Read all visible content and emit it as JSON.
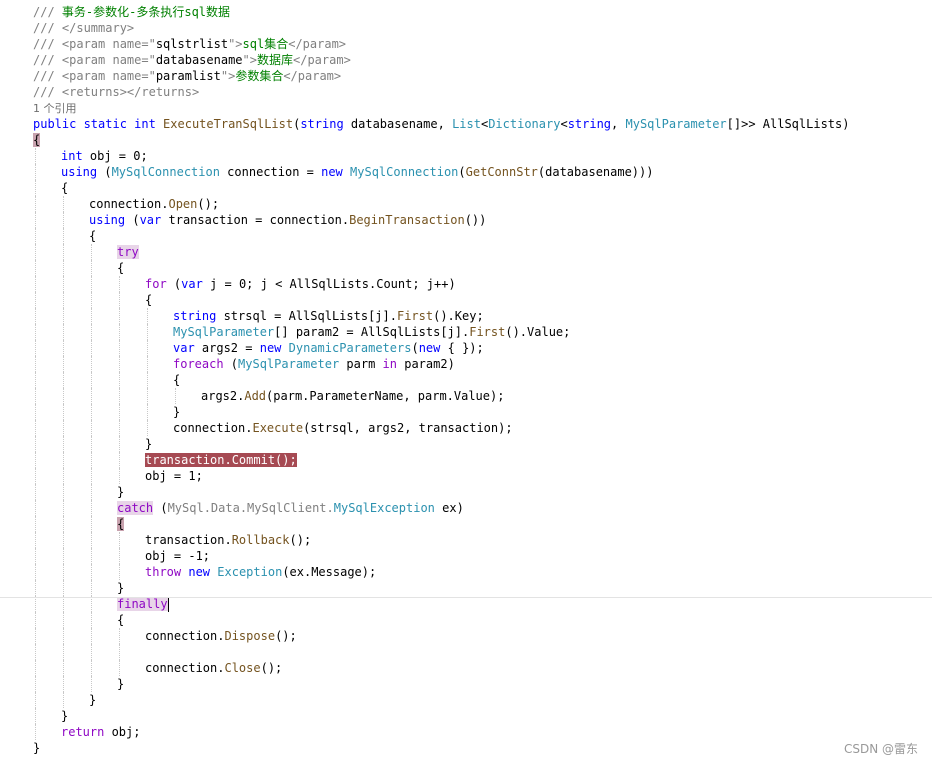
{
  "lines": [
    {
      "indent": 0,
      "tokens": [
        [
          "doc",
          "/// "
        ],
        [
          "comment",
          "事务-参数化-多条执行sql数据"
        ]
      ]
    },
    {
      "indent": 0,
      "tokens": [
        [
          "doc",
          "/// </summary>"
        ]
      ]
    },
    {
      "indent": 0,
      "tokens": [
        [
          "doc",
          "/// <param name=\""
        ],
        [
          "plain",
          "sqlstrlist"
        ],
        [
          "doc",
          "\">"
        ],
        [
          "comment",
          "sql集合"
        ],
        [
          "doc",
          "</param>"
        ]
      ]
    },
    {
      "indent": 0,
      "tokens": [
        [
          "doc",
          "/// <param name=\""
        ],
        [
          "plain",
          "databasename"
        ],
        [
          "doc",
          "\">"
        ],
        [
          "comment",
          "数据库"
        ],
        [
          "doc",
          "</param>"
        ]
      ]
    },
    {
      "indent": 0,
      "tokens": [
        [
          "doc",
          "/// <param name=\""
        ],
        [
          "plain",
          "paramlist"
        ],
        [
          "doc",
          "\">"
        ],
        [
          "comment",
          "参数集合"
        ],
        [
          "doc",
          "</param>"
        ]
      ]
    },
    {
      "indent": 0,
      "tokens": [
        [
          "doc",
          "/// <returns></returns>"
        ]
      ]
    },
    {
      "indent": 0,
      "tokens": [
        [
          "refs",
          "1 个引用"
        ]
      ]
    },
    {
      "indent": 0,
      "tokens": [
        [
          "kw",
          "public static int "
        ],
        [
          "method",
          "ExecuteTranSqlList"
        ],
        [
          "plain",
          "("
        ],
        [
          "kw",
          "string"
        ],
        [
          "plain",
          " databasename, "
        ],
        [
          "type",
          "List"
        ],
        [
          "plain",
          "<"
        ],
        [
          "type",
          "Dictionary"
        ],
        [
          "plain",
          "<"
        ],
        [
          "kw",
          "string"
        ],
        [
          "plain",
          ", "
        ],
        [
          "type",
          "MySqlParameter"
        ],
        [
          "plain",
          "[]>> AllSqlLists)"
        ]
      ]
    },
    {
      "indent": 0,
      "tokens": [
        [
          "hlbrace",
          "{"
        ]
      ]
    },
    {
      "indent": 1,
      "tokens": [
        [
          "kw",
          "int"
        ],
        [
          "plain",
          " obj = 0;"
        ]
      ]
    },
    {
      "indent": 1,
      "tokens": [
        [
          "kw",
          "using"
        ],
        [
          "plain",
          " ("
        ],
        [
          "type",
          "MySqlConnection"
        ],
        [
          "plain",
          " connection = "
        ],
        [
          "kw",
          "new"
        ],
        [
          "plain",
          " "
        ],
        [
          "type",
          "MySqlConnection"
        ],
        [
          "plain",
          "("
        ],
        [
          "method",
          "GetConnStr"
        ],
        [
          "plain",
          "(databasename)))"
        ]
      ]
    },
    {
      "indent": 1,
      "tokens": [
        [
          "plain",
          "{"
        ]
      ]
    },
    {
      "indent": 2,
      "tokens": [
        [
          "plain",
          "connection."
        ],
        [
          "method",
          "Open"
        ],
        [
          "plain",
          "();"
        ]
      ]
    },
    {
      "indent": 2,
      "tokens": [
        [
          "kw",
          "using"
        ],
        [
          "plain",
          " ("
        ],
        [
          "kw",
          "var"
        ],
        [
          "plain",
          " transaction = connection."
        ],
        [
          "method",
          "BeginTransaction"
        ],
        [
          "plain",
          "())"
        ]
      ]
    },
    {
      "indent": 2,
      "tokens": [
        [
          "plain",
          "{"
        ]
      ]
    },
    {
      "indent": 3,
      "tokens": [
        [
          "hlword",
          "try"
        ]
      ]
    },
    {
      "indent": 3,
      "tokens": [
        [
          "plain",
          "{"
        ]
      ]
    },
    {
      "indent": 4,
      "tokens": [
        [
          "kw2",
          "for"
        ],
        [
          "plain",
          " ("
        ],
        [
          "kw",
          "var"
        ],
        [
          "plain",
          " j = 0; j < AllSqlLists.Count; j++)"
        ]
      ]
    },
    {
      "indent": 4,
      "tokens": [
        [
          "plain",
          "{"
        ]
      ]
    },
    {
      "indent": 5,
      "tokens": [
        [
          "kw",
          "string"
        ],
        [
          "plain",
          " strsql = AllSqlLists[j]."
        ],
        [
          "method",
          "First"
        ],
        [
          "plain",
          "().Key;"
        ]
      ]
    },
    {
      "indent": 5,
      "tokens": [
        [
          "type",
          "MySqlParameter"
        ],
        [
          "plain",
          "[] param2 = AllSqlLists[j]."
        ],
        [
          "method",
          "First"
        ],
        [
          "plain",
          "().Value;"
        ]
      ]
    },
    {
      "indent": 5,
      "tokens": [
        [
          "kw",
          "var"
        ],
        [
          "plain",
          " args2 = "
        ],
        [
          "kw",
          "new"
        ],
        [
          "plain",
          " "
        ],
        [
          "type",
          "DynamicParameters"
        ],
        [
          "plain",
          "("
        ],
        [
          "kw",
          "new"
        ],
        [
          "plain",
          " { });"
        ]
      ]
    },
    {
      "indent": 5,
      "tokens": [
        [
          "kw2",
          "foreach"
        ],
        [
          "plain",
          " ("
        ],
        [
          "type",
          "MySqlParameter"
        ],
        [
          "plain",
          " parm "
        ],
        [
          "kw2",
          "in"
        ],
        [
          "plain",
          " param2)"
        ]
      ]
    },
    {
      "indent": 5,
      "tokens": [
        [
          "plain",
          "{"
        ]
      ]
    },
    {
      "indent": 6,
      "tokens": [
        [
          "plain",
          "args2."
        ],
        [
          "method",
          "Add"
        ],
        [
          "plain",
          "(parm.ParameterName, parm.Value);"
        ]
      ]
    },
    {
      "indent": 5,
      "tokens": [
        [
          "plain",
          "}"
        ]
      ]
    },
    {
      "indent": 5,
      "tokens": [
        [
          "plain",
          "connection."
        ],
        [
          "method",
          "Execute"
        ],
        [
          "plain",
          "(strsql, args2, transaction);"
        ]
      ]
    },
    {
      "indent": 4,
      "tokens": [
        [
          "plain",
          "}"
        ]
      ]
    },
    {
      "indent": 4,
      "tokens": [
        [
          "hlred",
          "transaction.Commit();"
        ]
      ]
    },
    {
      "indent": 4,
      "tokens": [
        [
          "plain",
          "obj = 1;"
        ]
      ]
    },
    {
      "indent": 3,
      "tokens": [
        [
          "plain",
          "}"
        ]
      ]
    },
    {
      "indent": 3,
      "tokens": [
        [
          "hlword",
          "catch"
        ],
        [
          "plain",
          " ("
        ],
        [
          "doc",
          "MySql.Data.MySqlClient."
        ],
        [
          "type",
          "MySqlException"
        ],
        [
          "plain",
          " ex)"
        ]
      ]
    },
    {
      "indent": 3,
      "tokens": [
        [
          "hlbrace",
          "{"
        ]
      ]
    },
    {
      "indent": 4,
      "tokens": [
        [
          "plain",
          "transaction."
        ],
        [
          "method",
          "Rollback"
        ],
        [
          "plain",
          "();"
        ]
      ]
    },
    {
      "indent": 4,
      "tokens": [
        [
          "plain",
          "obj = -1;"
        ]
      ]
    },
    {
      "indent": 4,
      "tokens": [
        [
          "kw2",
          "throw"
        ],
        [
          "plain",
          " "
        ],
        [
          "kw",
          "new"
        ],
        [
          "plain",
          " "
        ],
        [
          "type",
          "Exception"
        ],
        [
          "plain",
          "(ex.Message);"
        ]
      ]
    },
    {
      "indent": 3,
      "tokens": [
        [
          "plain",
          "}"
        ]
      ]
    },
    {
      "indent": 3,
      "tokens": [
        [
          "hlword",
          "finally"
        ],
        [
          "caret",
          ""
        ]
      ]
    },
    {
      "indent": 3,
      "tokens": [
        [
          "plain",
          "{"
        ]
      ]
    },
    {
      "indent": 4,
      "tokens": [
        [
          "plain",
          "connection."
        ],
        [
          "method",
          "Dispose"
        ],
        [
          "plain",
          "();"
        ]
      ]
    },
    {
      "indent": 4,
      "tokens": []
    },
    {
      "indent": 4,
      "tokens": [
        [
          "plain",
          "connection."
        ],
        [
          "method",
          "Close"
        ],
        [
          "plain",
          "();"
        ]
      ]
    },
    {
      "indent": 3,
      "tokens": [
        [
          "plain",
          "}"
        ]
      ]
    },
    {
      "indent": 2,
      "tokens": [
        [
          "plain",
          "}"
        ]
      ]
    },
    {
      "indent": 1,
      "tokens": [
        [
          "plain",
          "}"
        ]
      ]
    },
    {
      "indent": 1,
      "tokens": [
        [
          "kw2",
          "return"
        ],
        [
          "plain",
          " obj;"
        ]
      ]
    },
    {
      "indent": 0,
      "tokens": [
        [
          "plain",
          "}"
        ]
      ]
    }
  ],
  "watermark": "CSDN @雷东"
}
